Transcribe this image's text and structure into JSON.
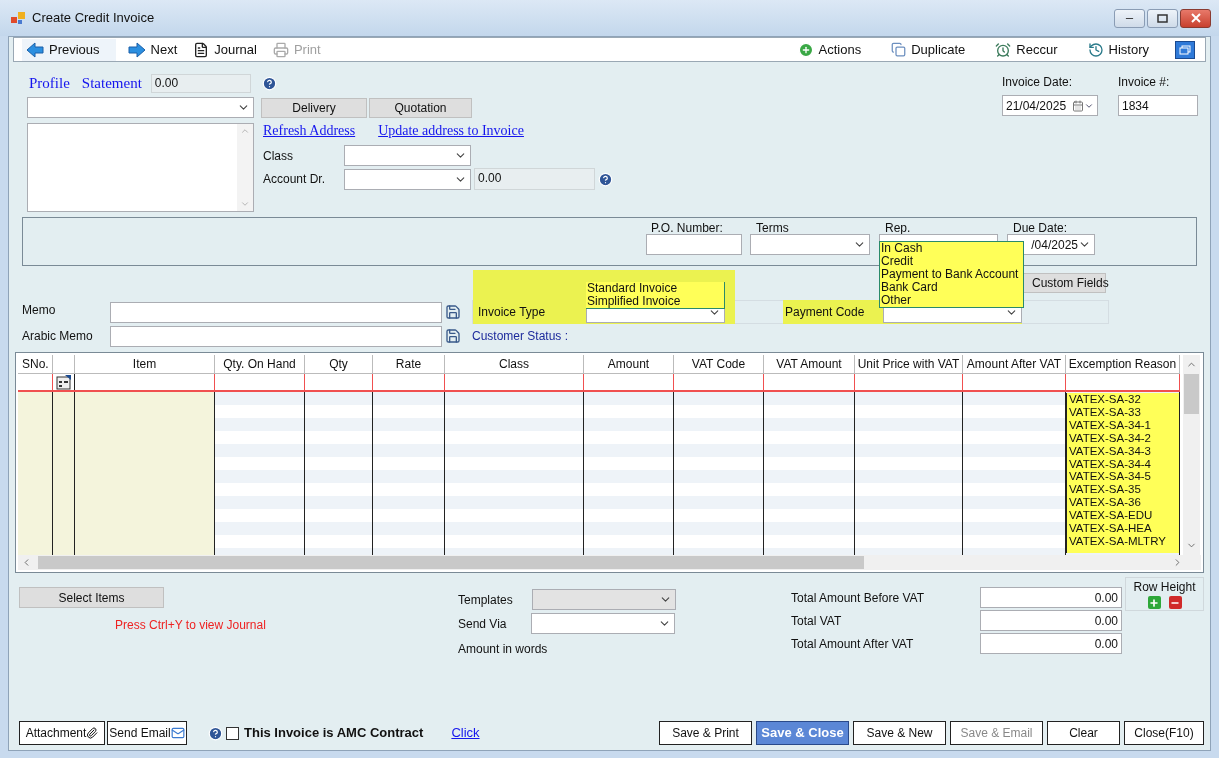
{
  "window": {
    "title": "Create Credit Invoice"
  },
  "toolbar": {
    "left": [
      {
        "label": "Previous",
        "kind": "back",
        "disabled": false
      },
      {
        "label": "Next",
        "kind": "forward",
        "disabled": false
      },
      {
        "label": "Journal",
        "kind": "journal",
        "disabled": false
      },
      {
        "label": "Print",
        "kind": "print",
        "disabled": true
      }
    ],
    "right": [
      {
        "label": "Actions",
        "kind": "actions"
      },
      {
        "label": "Duplicate",
        "kind": "duplicate"
      },
      {
        "label": "Reccur",
        "kind": "recur"
      },
      {
        "label": "History",
        "kind": "history"
      }
    ]
  },
  "customer": {
    "profile_link": "Profile",
    "statement_link": "Statement",
    "statement_value": "0.00",
    "delivery_button": "Delivery",
    "quotation_button": "Quotation",
    "refresh_link": "Refresh Address",
    "update_link": "Update address to Invoice",
    "class_label": "Class",
    "account_label": "Account Dr.",
    "account_value": "0.00"
  },
  "invoice": {
    "date_label": "Invoice Date:",
    "date": "21/04/2025",
    "number_label": "Invoice #:",
    "number": "1834"
  },
  "details": {
    "po_label": "P.O. Number:",
    "terms_label": "Terms",
    "rep_label": "Rep.",
    "due_date_label": "Due Date:",
    "due_date": "/04/2025"
  },
  "custom_fields_button": "Custom Fields",
  "memo": {
    "memo_label": "Memo",
    "arabic_memo_label": "Arabic Memo"
  },
  "invoice_type": {
    "label": "Invoice Type",
    "options": [
      "Standard Invoice",
      "Simplified Invoice"
    ]
  },
  "payment_code": {
    "label": "Payment Code",
    "options": [
      "In Cash",
      "Credit",
      "Payment to Bank Account",
      "Bank Card",
      "Other"
    ]
  },
  "customer_status": "Customer Status :",
  "grid": {
    "columns": [
      "SNo.",
      "Item",
      "Qty. On Hand",
      "Qty",
      "Rate",
      "Class",
      "Amount",
      "VAT Code",
      "VAT Amount",
      "Unit Price with VAT",
      "Amount After VAT",
      "Excemption Reason"
    ],
    "exemption_options": [
      "VATEX-SA-32",
      "VATEX-SA-33",
      "VATEX-SA-34-1",
      "VATEX-SA-34-2",
      "VATEX-SA-34-3",
      "VATEX-SA-34-4",
      "VATEX-SA-34-5",
      "VATEX-SA-35",
      "VATEX-SA-36",
      "VATEX-SA-EDU",
      "VATEX-SA-HEA",
      "VATEX-SA-MLTRY"
    ]
  },
  "footer": {
    "select_items_button": "Select Items",
    "hint": "Press Ctrl+Y to view Journal",
    "templates": {
      "label": "Templates",
      "disabled": true
    },
    "send_via": {
      "label": "Send Via",
      "disabled": false
    },
    "amount_in_words_label": "Amount in words",
    "totals": [
      {
        "label": "Total Amount Before VAT",
        "value": "0.00"
      },
      {
        "label": "Total VAT",
        "value": "0.00"
      },
      {
        "label": "Total Amount After VAT",
        "value": "0.00"
      }
    ],
    "row_height_label": "Row Height",
    "attachment_button": "Attachment",
    "send_email_button": "Send Email",
    "amc": {
      "label": "This Invoice is AMC Contract",
      "checked": false
    },
    "click_link": "Click",
    "actions": [
      {
        "label": "Save & Print",
        "primary": false,
        "disabled": false
      },
      {
        "label": "Save & Close",
        "primary": true,
        "disabled": false
      },
      {
        "label": "Save & New",
        "primary": false,
        "disabled": false
      },
      {
        "label": "Save & Email",
        "primary": false,
        "disabled": true
      },
      {
        "label": "Clear",
        "primary": false,
        "disabled": false
      },
      {
        "label": "Close(F10)",
        "primary": false,
        "disabled": false
      }
    ]
  }
}
